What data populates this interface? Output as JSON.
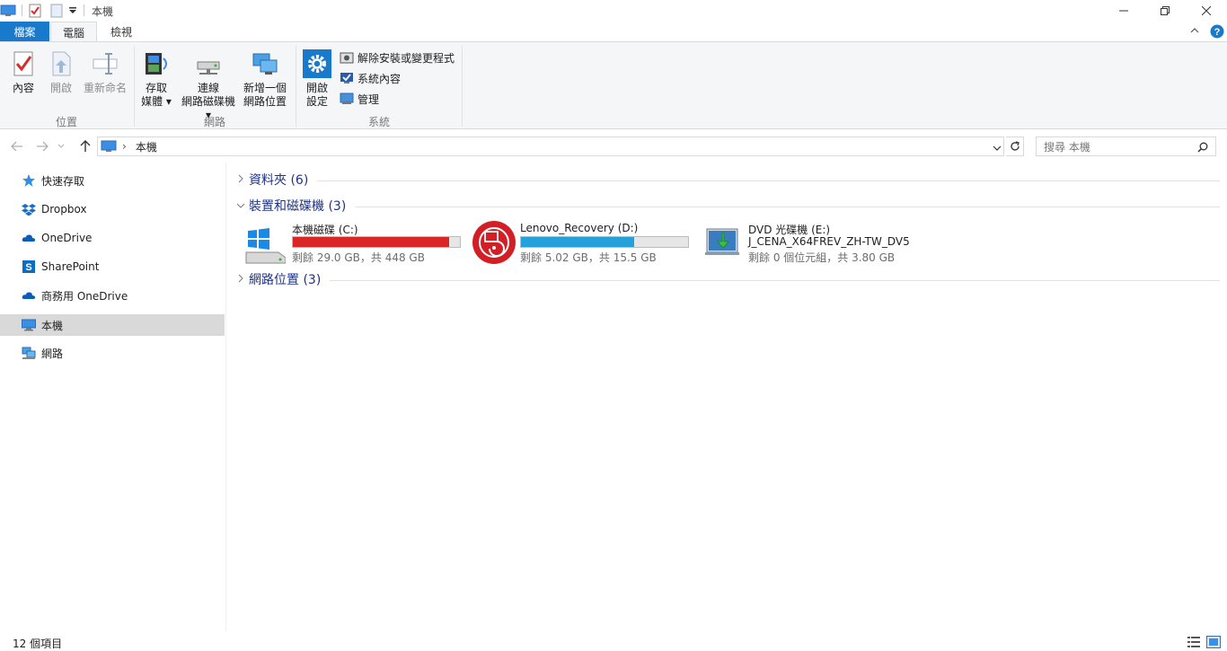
{
  "window": {
    "title": "本機"
  },
  "tabs": {
    "file": "檔案",
    "computer": "電腦",
    "view": "檢視"
  },
  "ribbon": {
    "location_group": {
      "label": "位置",
      "properties": "內容",
      "open": "開啟",
      "rename": "重新命名"
    },
    "network_group": {
      "label": "網路",
      "access_media_l1": "存取",
      "access_media_l2": "媒體",
      "map_drive_l1": "連線",
      "map_drive_l2": "網路磁碟機",
      "add_location_l1": "新增一個",
      "add_location_l2": "網路位置"
    },
    "system_group": {
      "label": "系統",
      "open_settings_l1": "開啟",
      "open_settings_l2": "設定",
      "uninstall": "解除安裝或變更程式",
      "system_properties": "系統內容",
      "manage": "管理"
    }
  },
  "address": {
    "path": "本機",
    "search_placeholder": "搜尋 本機"
  },
  "sidebar": {
    "items": [
      {
        "label": "快速存取",
        "icon": "star-icon"
      },
      {
        "label": "Dropbox",
        "icon": "dropbox-icon"
      },
      {
        "label": "OneDrive",
        "icon": "cloud-icon"
      },
      {
        "label": "SharePoint",
        "icon": "sharepoint-icon"
      },
      {
        "label": "商務用 OneDrive",
        "icon": "cloud-icon"
      },
      {
        "label": "本機",
        "icon": "computer-icon"
      },
      {
        "label": "網路",
        "icon": "network-icon"
      }
    ]
  },
  "sections": {
    "folders": "資料夾 (6)",
    "devices": "裝置和磁碟機 (3)",
    "network_locations": "網路位置 (3)"
  },
  "drives": [
    {
      "name": "本機磁碟 (C:)",
      "free": "剩餘 29.0 GB，共 448 GB",
      "used_fraction": 0.935,
      "bar_color": "#da2626"
    },
    {
      "name": "Lenovo_Recovery (D:)",
      "free": "剩餘 5.02 GB，共 15.5 GB",
      "used_fraction": 0.676,
      "bar_color": "#26a0da"
    },
    {
      "name": "DVD 光碟機 (E:)",
      "label2": "J_CENA_X64FREV_ZH-TW_DV5",
      "free": "剩餘 0 個位元組，共 3.80 GB"
    }
  ],
  "status": {
    "count": "12 個項目"
  }
}
